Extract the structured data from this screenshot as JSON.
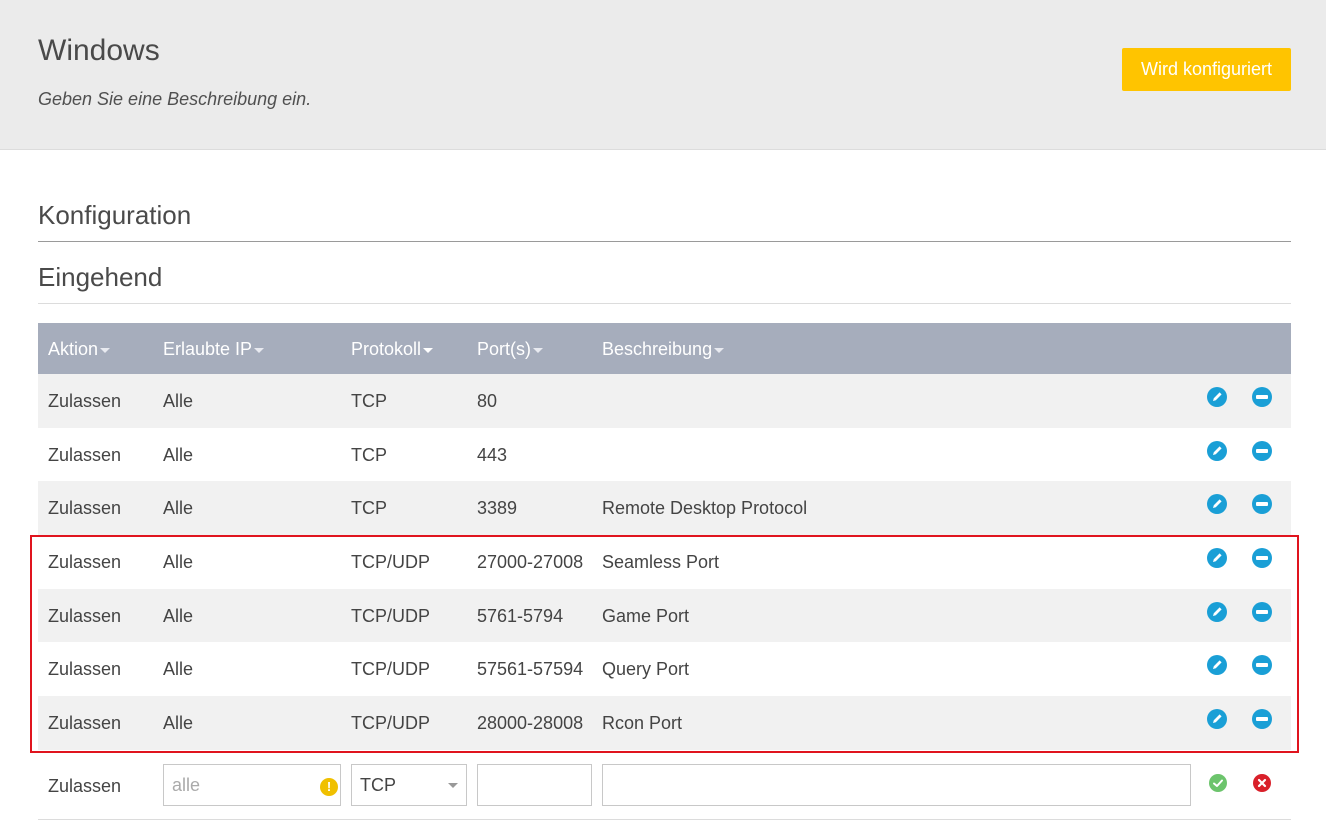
{
  "header": {
    "title": "Windows",
    "subtitle": "Geben Sie eine Beschreibung ein.",
    "status_button": "Wird konfiguriert"
  },
  "sections": {
    "config_title": "Konfiguration",
    "inbound_title": "Eingehend"
  },
  "table": {
    "columns": [
      "Aktion",
      "Erlaubte IP",
      "Protokoll",
      "Port(s)",
      "Beschreibung"
    ],
    "rows": [
      {
        "action": "Zulassen",
        "ip": "Alle",
        "protocol": "TCP",
        "ports": "80",
        "description": ""
      },
      {
        "action": "Zulassen",
        "ip": "Alle",
        "protocol": "TCP",
        "ports": "443",
        "description": ""
      },
      {
        "action": "Zulassen",
        "ip": "Alle",
        "protocol": "TCP",
        "ports": "3389",
        "description": "Remote Desktop Protocol"
      },
      {
        "action": "Zulassen",
        "ip": "Alle",
        "protocol": "TCP/UDP",
        "ports": "27000-27008",
        "description": "Seamless Port"
      },
      {
        "action": "Zulassen",
        "ip": "Alle",
        "protocol": "TCP/UDP",
        "ports": "5761-5794",
        "description": "Game Port"
      },
      {
        "action": "Zulassen",
        "ip": "Alle",
        "protocol": "TCP/UDP",
        "ports": "57561-57594",
        "description": "Query Port"
      },
      {
        "action": "Zulassen",
        "ip": "Alle",
        "protocol": "TCP/UDP",
        "ports": "28000-28008",
        "description": "Rcon Port"
      }
    ]
  },
  "new_rule": {
    "action": "Zulassen",
    "ip_placeholder": "alle",
    "protocol_selected": "TCP",
    "ports_value": "",
    "description_value": ""
  },
  "colors": {
    "accent": "#1a9fd6",
    "status_button": "#ffc400",
    "table_header": "#a6adbc",
    "highlight": "#e0141e",
    "confirm": "#6cc46c",
    "cancel": "#d9202a"
  }
}
